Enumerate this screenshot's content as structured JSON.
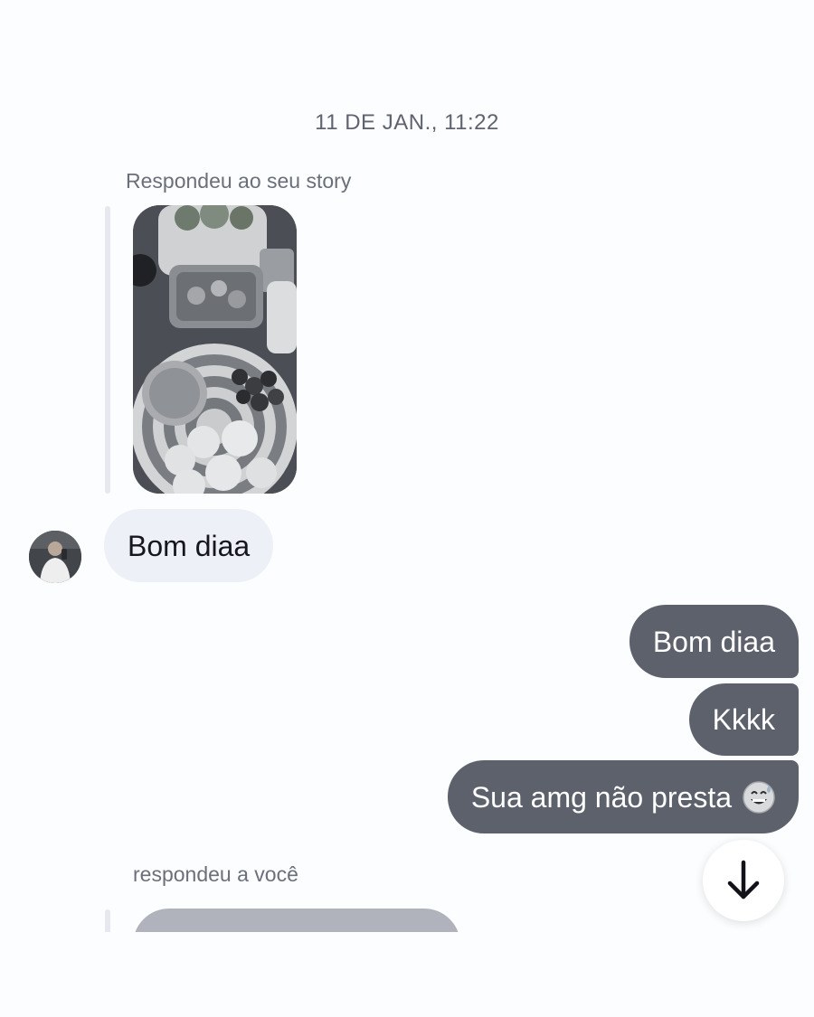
{
  "thread": {
    "timestamp": "11 DE JAN., 11:22",
    "story_reply_label": "Respondeu ao seu story",
    "reply_to_you_label": "respondeu a você"
  },
  "messages": {
    "incoming": [
      {
        "text": "Bom diaa"
      }
    ],
    "outgoing": [
      {
        "text": "Bom diaa"
      },
      {
        "text": "Kkkk"
      },
      {
        "text": "Sua amg não presta",
        "emoji": "grinning-sweat-emoji"
      }
    ]
  },
  "icons": {
    "scroll_down": "arrow-down-icon",
    "avatar": "profile-photo",
    "story": "story-photo-breakfast-table"
  },
  "colors": {
    "background": "#fbfdfe",
    "incoming_bubble": "#eef0f8",
    "outgoing_bubble": "#5d616c",
    "timestamp_text": "#5f6370"
  }
}
